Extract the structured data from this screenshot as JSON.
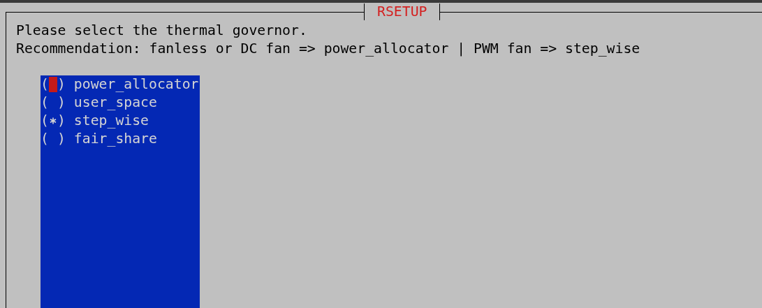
{
  "dialog": {
    "title": "RSETUP"
  },
  "prompt": [
    "Please select the thermal governor.",
    "Recommendation: fanless or DC fan => power_allocator | PWM fan => step_wise"
  ],
  "radio_brackets": {
    "open": "(",
    "close": ")"
  },
  "options": [
    {
      "label": "power_allocator",
      "selected": false,
      "focused": true
    },
    {
      "label": "user_space",
      "selected": false,
      "focused": false
    },
    {
      "label": "step_wise",
      "selected": true,
      "focused": false
    },
    {
      "label": "fair_share",
      "selected": false,
      "focused": false
    }
  ]
}
